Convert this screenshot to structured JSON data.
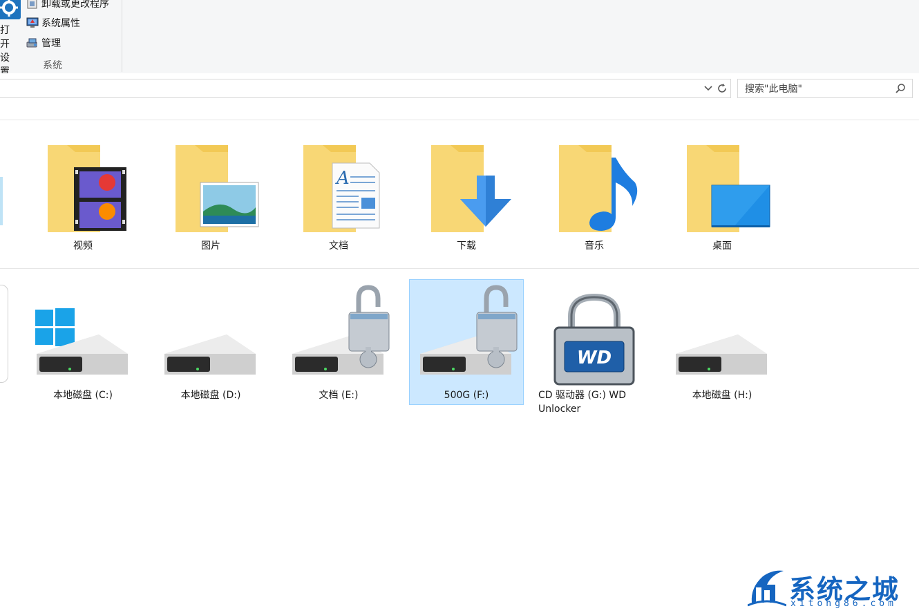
{
  "ribbon": {
    "open_settings_label": "打开设置",
    "commands": [
      {
        "label": "卸载或更改程序",
        "icon": "uninstall-icon"
      },
      {
        "label": "系统属性",
        "icon": "system-properties-icon"
      },
      {
        "label": "管理",
        "icon": "manage-icon"
      }
    ],
    "group_label": "系统"
  },
  "address_bar": {
    "value": "",
    "dropdown_icon": "chevron-down-icon",
    "refresh_icon": "refresh-icon"
  },
  "search": {
    "placeholder": "搜索\"此电脑\"",
    "icon": "search-icon"
  },
  "folders": [
    {
      "label": "视频",
      "icon": "videos-folder-icon"
    },
    {
      "label": "图片",
      "icon": "pictures-folder-icon"
    },
    {
      "label": "文档",
      "icon": "documents-folder-icon"
    },
    {
      "label": "下载",
      "icon": "downloads-folder-icon"
    },
    {
      "label": "音乐",
      "icon": "music-folder-icon"
    },
    {
      "label": "桌面",
      "icon": "desktop-folder-icon"
    }
  ],
  "drives": [
    {
      "label": "本地磁盘 (C:)",
      "icon": "windows-drive-icon",
      "selected": false
    },
    {
      "label": "本地磁盘 (D:)",
      "icon": "drive-icon",
      "selected": false
    },
    {
      "label": "文档 (E:)",
      "icon": "locked-drive-icon",
      "selected": false
    },
    {
      "label": "500G (F:)",
      "icon": "locked-drive-icon",
      "selected": true
    },
    {
      "label_line1": "CD 驱动器 (G:) WD",
      "label_line2": "Unlocker",
      "icon": "wd-unlocker-icon",
      "selected": false
    },
    {
      "label": "本地磁盘 (H:)",
      "icon": "drive-icon",
      "selected": false
    }
  ],
  "watermark": {
    "title": "系统之城",
    "subtitle": "xitong86.com"
  },
  "colors": {
    "selection_bg": "#cce8ff",
    "selection_border": "#99d1ff",
    "folder_yellow": "#f8d775",
    "accent_blue": "#0078d7"
  }
}
